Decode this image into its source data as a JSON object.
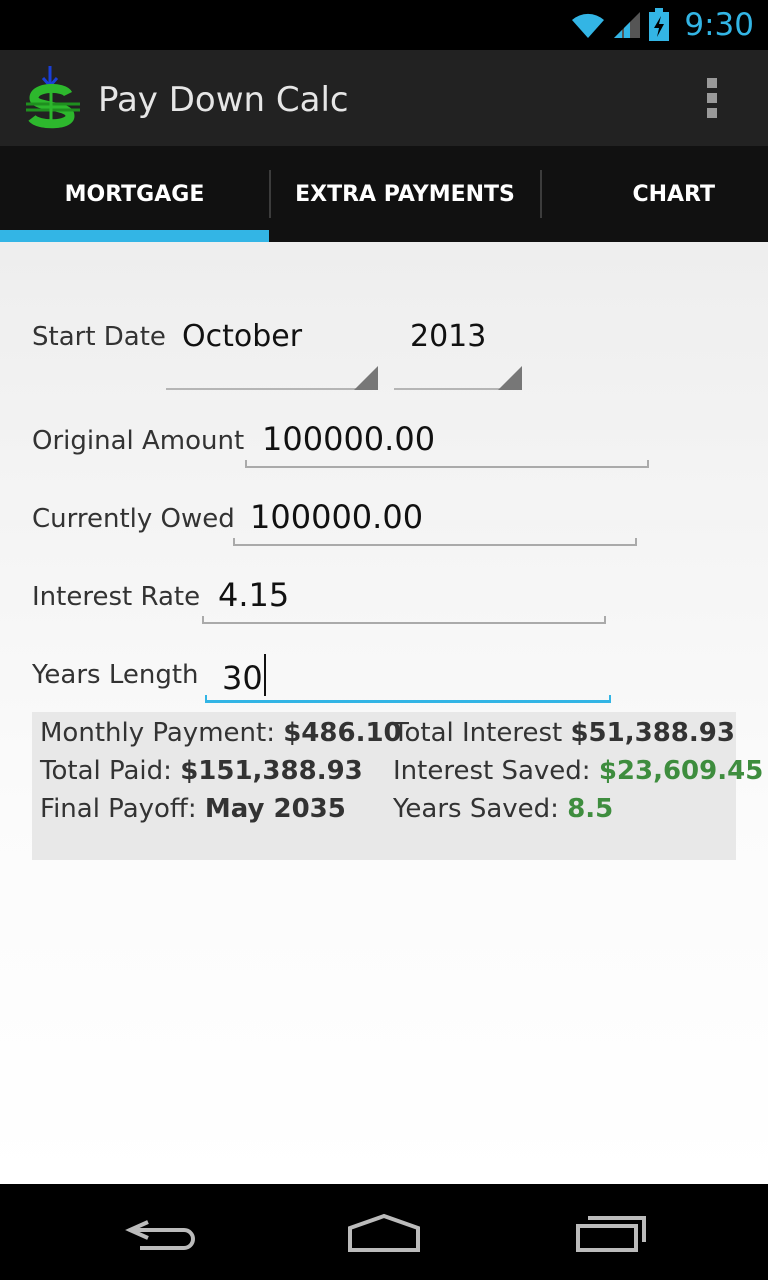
{
  "status": {
    "time": "9:30",
    "accent": "#33b5e5"
  },
  "app": {
    "title": "Pay Down Calc",
    "logo_icon": "dollar-down-arrow-icon",
    "overflow_icon": "overflow-menu-icon"
  },
  "tabs": [
    {
      "label": "MORTGAGE",
      "selected": true
    },
    {
      "label": "EXTRA PAYMENTS",
      "selected": false
    },
    {
      "label": "CHART",
      "selected": false
    }
  ],
  "form": {
    "start_date": {
      "label": "Start Date",
      "month": "October",
      "year": "2013"
    },
    "original_amount": {
      "label": "Original Amount",
      "value": "100000.00"
    },
    "currently_owed": {
      "label": "Currently Owed",
      "value": "100000.00"
    },
    "interest_rate": {
      "label": "Interest Rate",
      "value": "4.15"
    },
    "years_length": {
      "label": "Years Length",
      "value": "30"
    }
  },
  "results": {
    "monthly_payment": {
      "label": "Monthly Payment: ",
      "value": "$486.10"
    },
    "total_paid": {
      "label": "Total Paid: ",
      "value": "$151,388.93"
    },
    "final_payoff": {
      "label": "Final Payoff: ",
      "value": "May 2035"
    },
    "total_interest": {
      "label": "Total Interest ",
      "value": "$51,388.93"
    },
    "interest_saved": {
      "label": "Interest Saved: ",
      "value": "$23,609.45"
    },
    "years_saved": {
      "label": "Years Saved: ",
      "value": "8.5"
    },
    "positive_color": "#3e8d3e"
  },
  "navbar": {
    "back_icon": "back-icon",
    "home_icon": "home-icon",
    "recents_icon": "recent-apps-icon"
  }
}
